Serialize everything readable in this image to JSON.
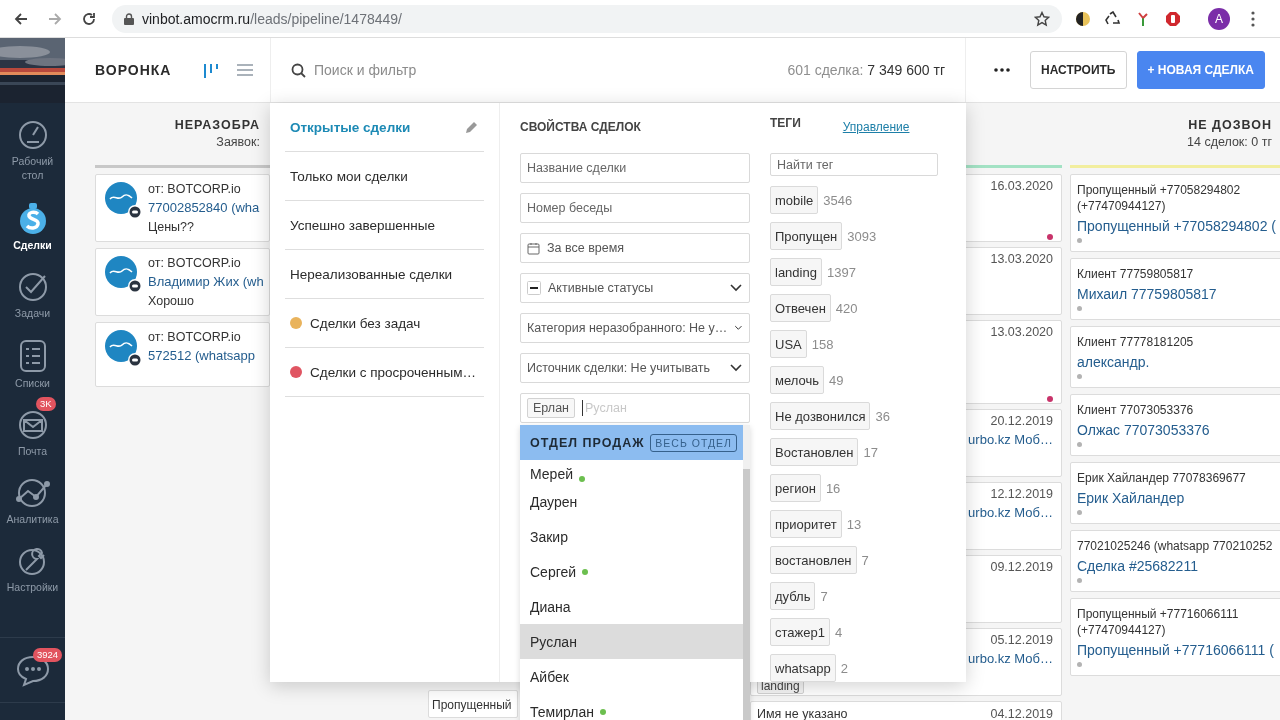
{
  "browser": {
    "url_host": "vinbot.amocrm.ru",
    "url_path": "/leads/pipeline/1478449/",
    "avatar": "A"
  },
  "nav": {
    "items": [
      {
        "label": "Рабочий стол",
        "kind": "dashboard",
        "selected": false
      },
      {
        "label": "Сделки",
        "kind": "deals",
        "selected": true
      },
      {
        "label": "Задачи",
        "kind": "tasks",
        "selected": false
      },
      {
        "label": "Списки",
        "kind": "lists",
        "selected": false
      },
      {
        "label": "Почта",
        "kind": "mail",
        "selected": false,
        "badge": "3K"
      },
      {
        "label": "Аналитика",
        "kind": "analytics",
        "selected": false
      },
      {
        "label": "Настройки",
        "kind": "settings",
        "selected": false
      }
    ],
    "chat_badge": "3924"
  },
  "header": {
    "title": "ВОРОНКА",
    "views": [
      {
        "kind": "pipeline",
        "selected": true
      },
      {
        "kind": "list",
        "selected": false
      }
    ],
    "search_placeholder": "Поиск и фильтр",
    "summary_label": "601 сделка:",
    "summary_value": "7 349 600 тг",
    "configure": "НАСТРОИТЬ",
    "new_deal": "+ НОВАЯ СДЕЛКА"
  },
  "board": {
    "unsorted": {
      "title": "НЕРАЗОБРА",
      "summary": "Заявок:",
      "color": "#c8c8c8",
      "cards": [
        {
          "from": "от: BOTCORP.io",
          "title": "77002852840 (wha",
          "text": "Цены??"
        },
        {
          "from": "от: BOTCORP.io",
          "title": "Владимир Жих (wh",
          "text": "Хорошо"
        },
        {
          "from": "от: BOTCORP.io",
          "title": "572512 (whatsapp"
        }
      ]
    },
    "column_2": {
      "cards": [
        {
          "caption": "Пропущенный"
        }
      ]
    },
    "column_3": {
      "color": "#a3e2c4",
      "cards": [
        {
          "date": "16.03.2020",
          "marked": true
        },
        {
          "date": "13.03.2020",
          "marked": false
        },
        {
          "date": "13.03.2020",
          "marked": true
        },
        {
          "date": "20.12.2019",
          "title": "urbo.kz Моб…",
          "marked": false
        },
        {
          "date": "12.12.2019",
          "title": "urbo.kz Моб…",
          "marked": false
        },
        {
          "date": "09.12.2019",
          "marked": false
        },
        {
          "date": "05.12.2019",
          "title": "urbo.kz Моб…",
          "tag": "landing",
          "marked": false
        },
        {
          "date": "04.12.2019",
          "caption": "Имя не указано",
          "marked": false
        }
      ]
    },
    "no_call": {
      "title": "НЕ ДОЗВОН",
      "summary": "14 сделок: 0 тг",
      "color": "#f2ee9e",
      "cards": [
        {
          "caption": "Пропущенный +77058294802 (+77470944127)",
          "title": "Пропущенный +77058294802 ("
        },
        {
          "caption": "Клиент 77759805817",
          "title": "Михаил 77759805817"
        },
        {
          "caption": "Клиент 77778181205",
          "title": "александр."
        },
        {
          "caption": "Клиент 77073053376",
          "title": "Олжас 77073053376"
        },
        {
          "caption": "Ерик Хайландер 77078369677",
          "title": "Ерик Хайландер"
        },
        {
          "caption": "77021025246 (whatsapp 770210252",
          "title": "Сделка #25682211"
        },
        {
          "caption": "Пропущенный +77716066111 (+77470944127)",
          "title": "Пропущенный +77716066111 ("
        }
      ]
    }
  },
  "filter": {
    "presets": [
      {
        "label": "Открытые сделки",
        "selected": true
      },
      {
        "label": "Только мои сделки",
        "selected": false
      },
      {
        "label": "Успешно завершенные",
        "selected": false
      },
      {
        "label": "Нереализованные сделки",
        "selected": false
      },
      {
        "label": "Сделки без задач",
        "selected": false,
        "color": "#e9b35c"
      },
      {
        "label": "Сделки с просроченным…",
        "selected": false,
        "color": "#e05562"
      }
    ],
    "properties_title": "СВОЙСТВА СДЕЛОК",
    "fields": [
      {
        "kind": "text",
        "placeholder": "Название сделки"
      },
      {
        "kind": "text",
        "placeholder": "Номер беседы"
      },
      {
        "kind": "date",
        "value": "За все время"
      },
      {
        "kind": "status",
        "value": "Активные статусы"
      },
      {
        "kind": "select",
        "value": "Категория неразобранного: Не у…"
      },
      {
        "kind": "select",
        "value": "Источник сделки: Не учитывать"
      },
      {
        "kind": "users",
        "chips": [
          "Ерлан"
        ],
        "placeholder": "Руслан"
      }
    ],
    "dropdown": {
      "group": "ОТДЕЛ ПРОДАЖ",
      "group_button": "ВЕСЬ ОТДЕЛ",
      "items": [
        {
          "name": "Мерей",
          "online": true,
          "selected": false
        },
        {
          "name": "Даурен",
          "online": false,
          "selected": false
        },
        {
          "name": "Закир",
          "online": false,
          "selected": false
        },
        {
          "name": "Сергей",
          "online": true,
          "selected": false
        },
        {
          "name": "Диана",
          "online": false,
          "selected": false
        },
        {
          "name": "Руслан",
          "online": false,
          "selected": true
        },
        {
          "name": "Айбек",
          "online": false,
          "selected": false
        },
        {
          "name": "Темирлан",
          "online": true,
          "selected": false
        }
      ]
    },
    "tags_title": "ТЕГИ",
    "tags_link": "Управление",
    "tags_placeholder": "Найти тег",
    "tags": [
      {
        "name": "mobile",
        "count": "3546"
      },
      {
        "name": "Пропущен",
        "count": "3093"
      },
      {
        "name": "landing",
        "count": "1397"
      },
      {
        "name": "Отвечен",
        "count": "420"
      },
      {
        "name": "USA",
        "count": "158"
      },
      {
        "name": "мелочь",
        "count": "49"
      },
      {
        "name": "Не дозвонился",
        "count": "36"
      },
      {
        "name": "Востановлен",
        "count": "17"
      },
      {
        "name": "регион",
        "count": "16"
      },
      {
        "name": "приоритет",
        "count": "13"
      },
      {
        "name": "востановлен",
        "count": "7"
      },
      {
        "name": "дубль",
        "count": "7"
      },
      {
        "name": "стажер1",
        "count": "4"
      },
      {
        "name": "whatsapp",
        "count": "2"
      }
    ]
  }
}
